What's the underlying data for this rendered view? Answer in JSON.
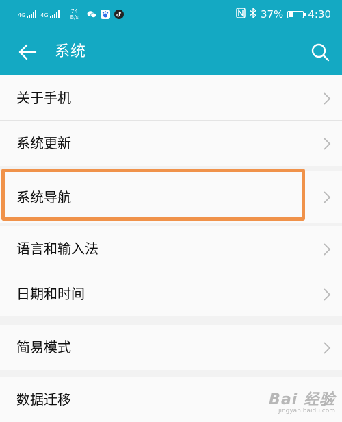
{
  "status_bar": {
    "network_1": "4G",
    "network_2": "4G",
    "net_speed_value": "74",
    "net_speed_unit": "B/s",
    "battery_percent": "37%",
    "battery_level": 0.37,
    "time": "4:30",
    "icons": [
      "signal-icon",
      "wechat-icon",
      "baidu-icon",
      "tiktok-icon",
      "nfc-icon",
      "bluetooth-icon",
      "battery-icon"
    ]
  },
  "app_bar": {
    "title": "系统",
    "back_icon": "arrow-left-icon",
    "search_icon": "search-icon"
  },
  "groups": [
    {
      "items": [
        {
          "label": "关于手机"
        },
        {
          "label": "系统更新"
        }
      ]
    },
    {
      "items": [
        {
          "label": "系统导航",
          "highlighted": true
        }
      ]
    },
    {
      "items": [
        {
          "label": "语言和输入法"
        },
        {
          "label": "日期和时间"
        }
      ]
    },
    {
      "items": [
        {
          "label": "简易模式"
        }
      ]
    },
    {
      "items": [
        {
          "label": "数据迁移"
        }
      ]
    }
  ],
  "colors": {
    "header": "#14a9c3",
    "highlight_border": "#f0924a",
    "background": "#f2f2f2",
    "row": "#fafafa"
  },
  "watermark": {
    "text": "Bai 经验",
    "url": "jingyan.baidu.com"
  }
}
